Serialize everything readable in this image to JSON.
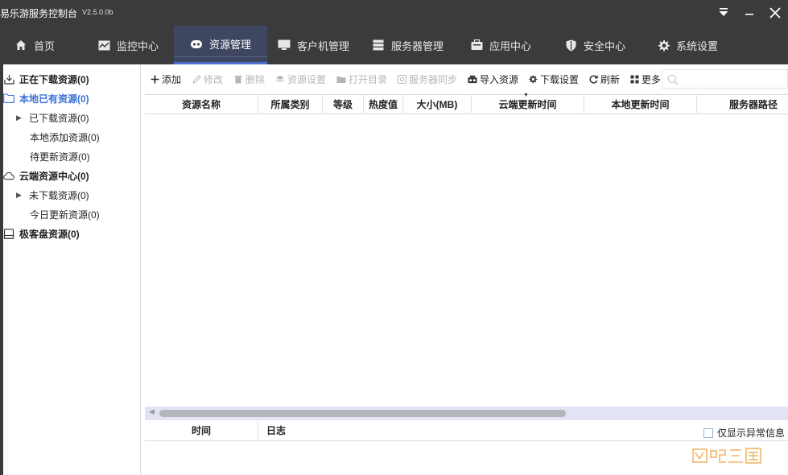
{
  "app": {
    "title": "易乐游服务控制台",
    "version": "V2.5.0.0b"
  },
  "nav": {
    "items": [
      {
        "label": "首页",
        "icon": "home-icon"
      },
      {
        "label": "监控中心",
        "icon": "monitor-chart-icon"
      },
      {
        "label": "资源管理",
        "icon": "resource-icon",
        "active": true
      },
      {
        "label": "客户机管理",
        "icon": "desktop-icon"
      },
      {
        "label": "服务器管理",
        "icon": "server-icon"
      },
      {
        "label": "应用中心",
        "icon": "app-box-icon"
      },
      {
        "label": "安全中心",
        "icon": "shield-icon"
      },
      {
        "label": "系统设置",
        "icon": "gear-icon"
      }
    ]
  },
  "tree": {
    "nodes": [
      {
        "label": "正在下载资源(0)",
        "icon": "download-icon",
        "level": 0
      },
      {
        "label": "本地已有资源(0)",
        "icon": "folder-icon",
        "level": 0,
        "selected": true
      },
      {
        "label": "已下载资源(0)",
        "level": 1,
        "expandable": true
      },
      {
        "label": "本地添加资源(0)",
        "level": 1
      },
      {
        "label": "待更新资源(0)",
        "level": 1
      },
      {
        "label": "云端资源中心(0)",
        "icon": "cloud-icon",
        "level": 0
      },
      {
        "label": "未下载资源(0)",
        "level": 1,
        "expandable": true
      },
      {
        "label": "今日更新资源(0)",
        "level": 1
      },
      {
        "label": "极客盘资源(0)",
        "icon": "disk-icon",
        "level": 0
      }
    ]
  },
  "toolbar": {
    "add": "添加",
    "edit": "修改",
    "delete": "删除",
    "resource_settings": "资源设置",
    "open_dir": "打开目录",
    "server_sync": "服务器同步",
    "import": "导入资源",
    "download_settings": "下载设置",
    "refresh": "刷新",
    "more": "更多"
  },
  "grid": {
    "columns": [
      "资源名称",
      "所属类别",
      "等级",
      "热度值",
      "大小(MB)",
      "云端更新时间",
      "本地更新时间",
      "服务器路径"
    ],
    "rows": []
  },
  "log": {
    "columns": [
      "时间",
      "日志"
    ],
    "only_errors_label": "仅显示异常信息",
    "only_errors_checked": false
  },
  "watermark": "网吧三国",
  "colors": {
    "titlebar_bg": "#3b3b3e",
    "active_tab_bg": "#3f4660",
    "active_tab_underline": "#4f6fd1",
    "selected_text": "#3a6fd8",
    "scrollbar_track": "#e3e3f6",
    "watermark": "#f0b56a"
  }
}
